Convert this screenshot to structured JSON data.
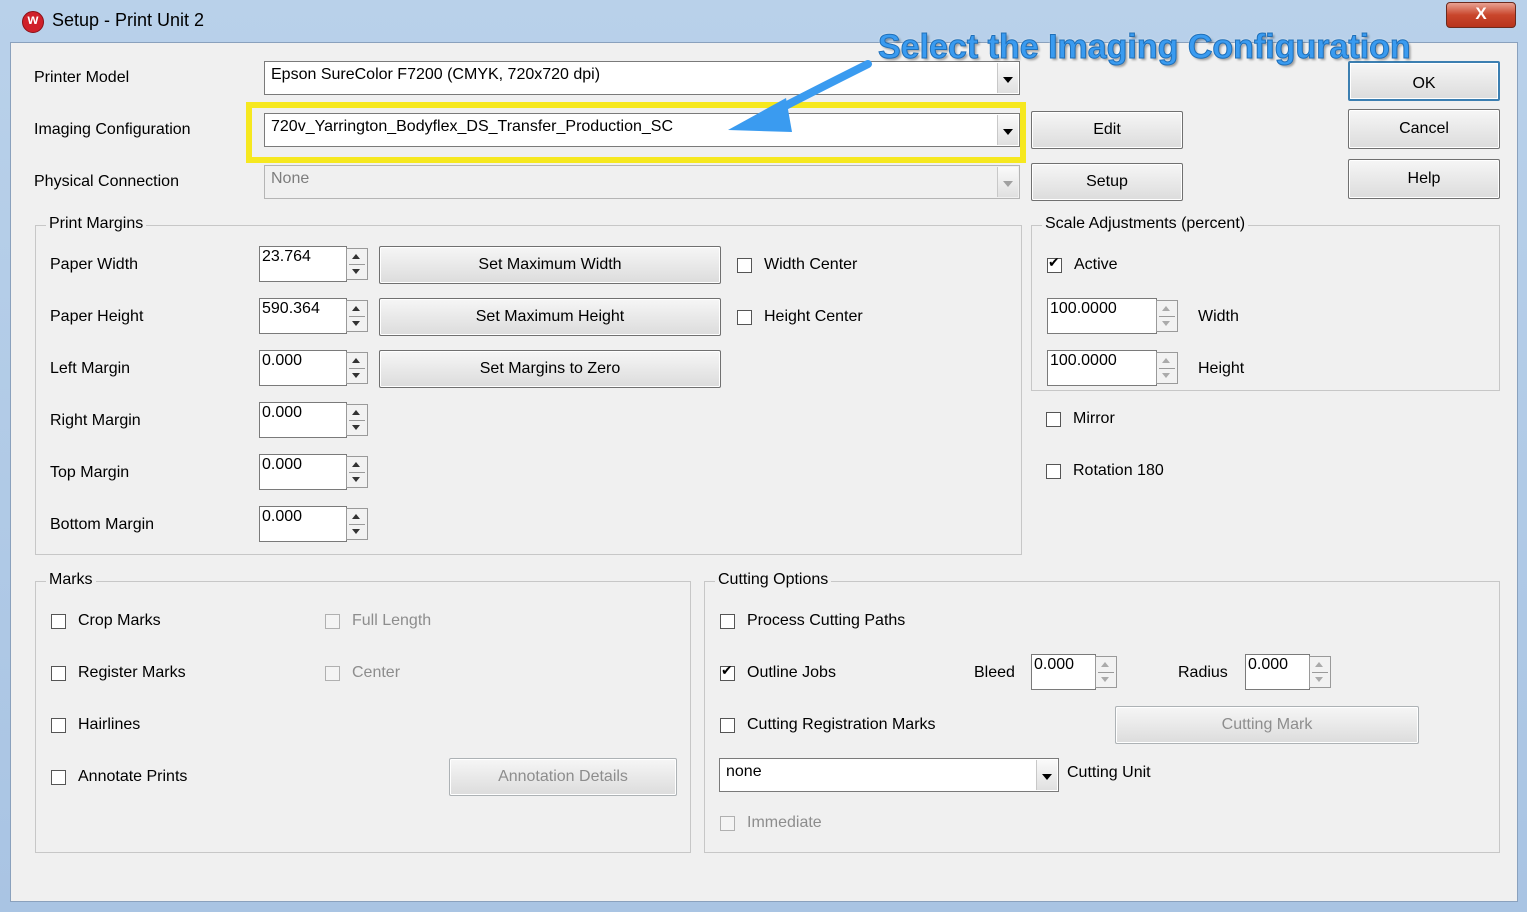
{
  "window": {
    "title": "Setup - Print Unit 2",
    "close_label": "X"
  },
  "fields": {
    "printer_model_label": "Printer Model",
    "printer_model_value": "Epson  SureColor F7200  (CMYK, 720x720 dpi)",
    "imaging_config_label": "Imaging Configuration",
    "imaging_config_value": "720v_Yarrington_Bodyflex_DS_Transfer_Production_SC",
    "physical_connection_label": "Physical Connection",
    "physical_connection_value": "None"
  },
  "buttons": {
    "ok": "OK",
    "cancel": "Cancel",
    "help": "Help",
    "edit": "Edit",
    "setup": "Setup"
  },
  "print_margins": {
    "title": "Print Margins",
    "paper_width_label": "Paper Width",
    "paper_width": "23.764",
    "paper_height_label": "Paper Height",
    "paper_height": "590.364",
    "left_margin_label": "Left Margin",
    "left_margin": "0.000",
    "right_margin_label": "Right Margin",
    "right_margin": "0.000",
    "top_margin_label": "Top Margin",
    "top_margin": "0.000",
    "bottom_margin_label": "Bottom Margin",
    "bottom_margin": "0.000",
    "set_max_width": "Set Maximum Width",
    "set_max_height": "Set Maximum Height",
    "set_margins_zero": "Set Margins to Zero",
    "width_center": "Width Center",
    "height_center": "Height Center"
  },
  "scale": {
    "title": "Scale Adjustments (percent)",
    "active": "Active",
    "width_value": "100.0000",
    "width_label": "Width",
    "height_value": "100.0000",
    "height_label": "Height",
    "mirror": "Mirror",
    "rotation": "Rotation  180"
  },
  "marks": {
    "title": "Marks",
    "crop_marks": "Crop Marks",
    "register_marks": "Register Marks",
    "hairlines": "Hairlines",
    "annotate_prints": "Annotate Prints",
    "full_length": "Full Length",
    "center": "Center",
    "annotation_details": "Annotation Details"
  },
  "cutting": {
    "title": "Cutting Options",
    "process_cutting_paths": "Process Cutting Paths",
    "outline_jobs": "Outline Jobs",
    "bleed_label": "Bleed",
    "bleed_value": "0.000",
    "radius_label": "Radius",
    "radius_value": "0.000",
    "cutting_registration_marks": "Cutting Registration Marks",
    "cutting_mark": "Cutting Mark",
    "cutting_unit_value": "none",
    "cutting_unit_label": "Cutting Unit",
    "immediate": "Immediate"
  },
  "annotation": {
    "callout_text": "Select the Imaging Configuration",
    "highlight_color": "#f6e81f",
    "arrow_color": "#3a9bf0"
  },
  "checked_state": {
    "active": true,
    "outline_jobs": true,
    "width_center": false,
    "height_center": false,
    "mirror": false,
    "rotation": false
  }
}
